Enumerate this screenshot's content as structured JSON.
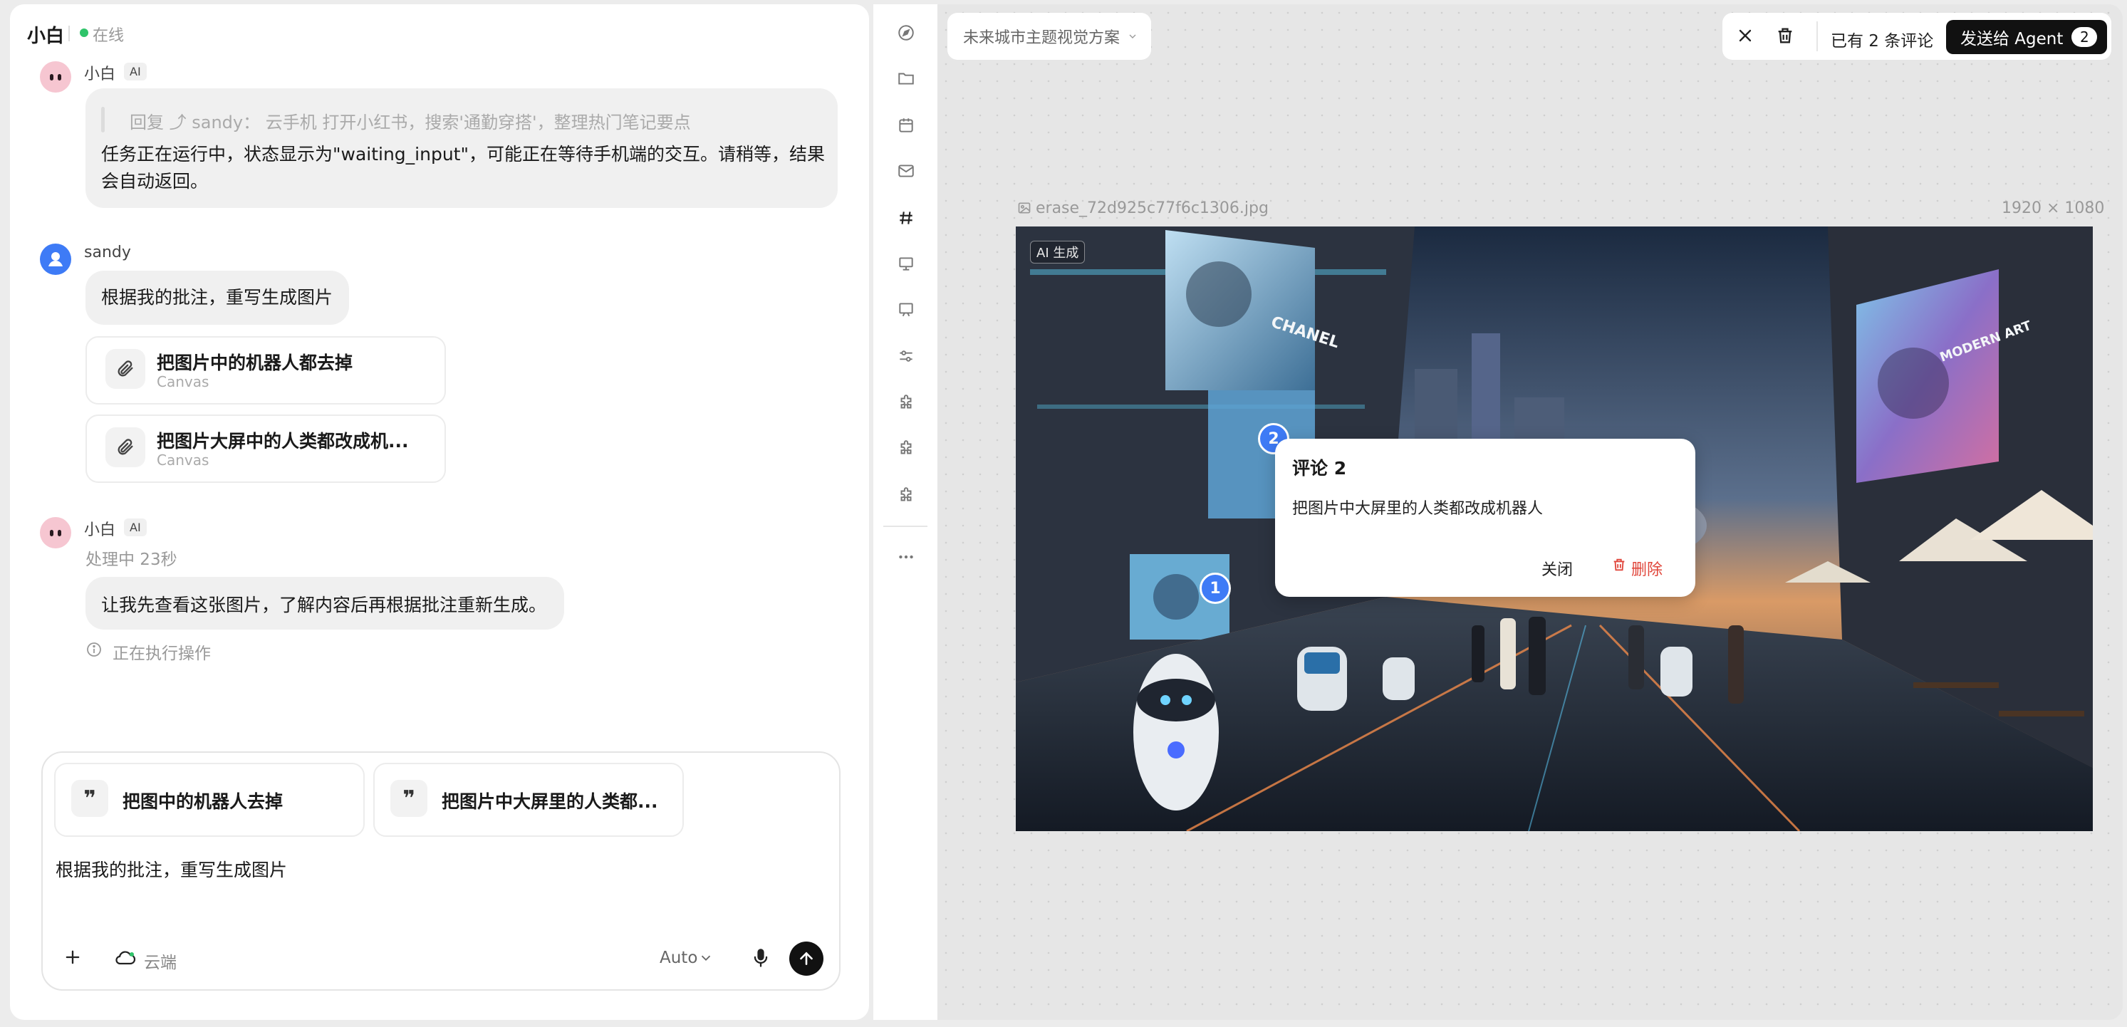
{
  "header": {
    "name": "小白",
    "status": "在线"
  },
  "messages": {
    "ai_first": {
      "sender": "小白",
      "badge": "AI",
      "reply_quote": "回复 ⤴ sandy： 云手机 打开小红书，搜索'通勤穿搭'，整理热门笔记要点",
      "text_line1": "任务正在运行中，状态显示为\"waiting_input\"，可能正在等待手机端的交互。请稍等，结果",
      "text_line2": "会自动返回。"
    },
    "user": {
      "sender": "sandy",
      "text": "根据我的批注，重写生成图片",
      "attachments": [
        {
          "title": "把图片中的机器人都去掉",
          "sub": "Canvas"
        },
        {
          "title": "把图片大屏中的人类都改成机...",
          "sub": "Canvas"
        }
      ]
    },
    "ai_second": {
      "sender": "小白",
      "badge": "AI",
      "processing": "处理中 23秒",
      "text": "让我先查看这张图片，了解内容后再根据批注重新生成。",
      "executing": "正在执行操作"
    }
  },
  "composer": {
    "chips": [
      "把图中的机器人去掉",
      "把图片中大屏里的人类都..."
    ],
    "text": "根据我的批注，重写生成图片",
    "cloud_label": "云端",
    "model": "Auto"
  },
  "rail": {
    "icons": [
      "compass-icon",
      "folder-icon",
      "calendar-icon",
      "mail-icon",
      "hash-icon",
      "presentation-icon",
      "board-icon",
      "sliders-icon",
      "puzzle-icon",
      "puzzle-icon",
      "puzzle-icon",
      "more-icon"
    ]
  },
  "canvas": {
    "project_title": "未来城市主题视觉方案",
    "comment_count_label": "已有 2 条评论",
    "send_label": "发送给 Agent",
    "send_count": "2",
    "file_name": "erase_72d925c77f6c1306.jpg",
    "dimensions": "1920 × 1080",
    "ai_tag": "AI 生成",
    "signs": [
      "CHANEL",
      "MODERN ART"
    ],
    "pins": [
      "1",
      "2"
    ],
    "popup": {
      "title": "评论 2",
      "body": "把图片中大屏里的人类都改成机器人",
      "close": "关闭",
      "delete": "删除"
    }
  },
  "colors": {
    "accent": "#3e7bf6",
    "online": "#2fc46a",
    "danger": "#e0453a",
    "ai_avatar": "#f6c6d1"
  }
}
